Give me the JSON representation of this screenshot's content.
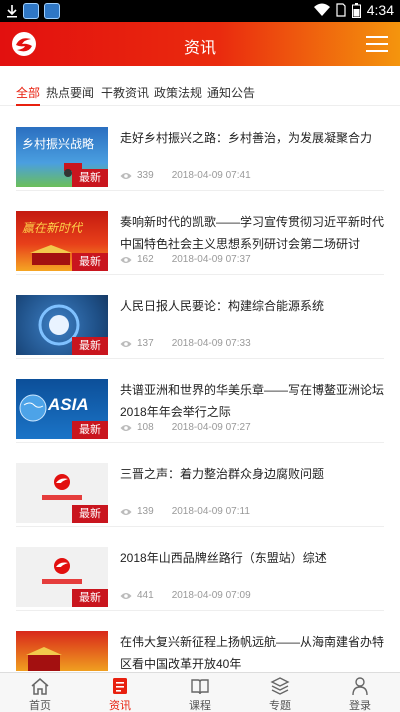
{
  "status": {
    "time": "4:34"
  },
  "header": {
    "title": "资讯"
  },
  "tabs": [
    {
      "label": "全部",
      "active": true
    },
    {
      "label": "热点要闻"
    },
    {
      "label": "干教资讯"
    },
    {
      "label": "政策法规"
    },
    {
      "label": "通知公告"
    }
  ],
  "badge_label": "最新",
  "articles": [
    {
      "title": "走好乡村振兴之路：乡村善治，为发展凝聚合力",
      "views": "339",
      "date": "2018-04-09 07:41",
      "thumb_text": "乡村振兴战略"
    },
    {
      "title": "奏响新时代的凯歌——学习宣传贯彻习近平新时代中国特色社会主义思想系列研讨会第二场研讨",
      "views": "162",
      "date": "2018-04-09 07:37",
      "thumb_text": "赢在新时代"
    },
    {
      "title": "人民日报人民要论：构建综合能源系统",
      "views": "137",
      "date": "2018-04-09 07:33"
    },
    {
      "title": "共谱亚洲和世界的华美乐章——写在博鳌亚洲论坛2018年年会举行之际",
      "views": "108",
      "date": "2018-04-09 07:27",
      "thumb_text": "ASIA"
    },
    {
      "title": "三晋之声：着力整治群众身边腐败问题",
      "views": "139",
      "date": "2018-04-09 07:11"
    },
    {
      "title": "2018年山西品牌丝路行（东盟站）综述",
      "views": "441",
      "date": "2018-04-09 07:09"
    },
    {
      "title": "在伟大复兴新征程上扬帆远航——从海南建省办特区看中国改革开放40年"
    }
  ],
  "bottom_nav": [
    {
      "label": "首页"
    },
    {
      "label": "资讯",
      "active": true
    },
    {
      "label": "课程"
    },
    {
      "label": "专题"
    },
    {
      "label": "登录"
    }
  ],
  "colors": {
    "brand_red": "#e2100f",
    "brand_orange": "#f4950d",
    "badge": "#c9151e"
  }
}
